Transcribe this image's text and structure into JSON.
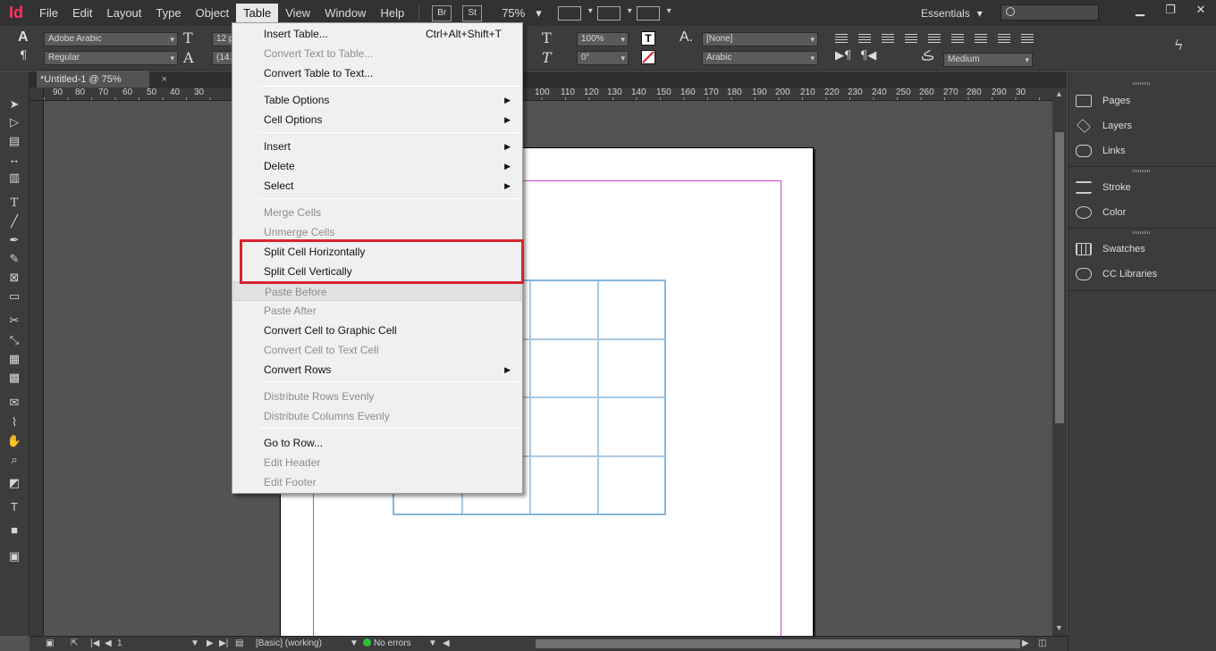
{
  "menubar": {
    "logo": "Id",
    "items": [
      "File",
      "Edit",
      "Layout",
      "Type",
      "Object",
      "Table",
      "View",
      "Window",
      "Help"
    ],
    "bridge": "Br",
    "stock": "St",
    "zoom": "75%",
    "zoom_arrow": "▾",
    "workspace": "Essentials",
    "workspace_arrow": "▾",
    "win_minimize": "▁",
    "win_restore": "❐",
    "win_close": "✕"
  },
  "control": {
    "font_family": "Adobe Arabic",
    "font_style": "Regular",
    "font_size": "12 p",
    "leading": "(14.4",
    "scale": "100%",
    "skew": "0°",
    "char_style": "[None]",
    "language": "Arabic",
    "kashida": "Medium"
  },
  "tab": {
    "title": "*Untitled-1 @ 75%",
    "close": "×"
  },
  "ruler_h": [
    "90",
    "80",
    "70",
    "60",
    "50",
    "40",
    "30",
    "100",
    "110",
    "120",
    "130",
    "140",
    "150",
    "160",
    "170",
    "180",
    "190",
    "200",
    "210",
    "220",
    "230",
    "240",
    "250",
    "260",
    "270",
    "280",
    "290",
    "30"
  ],
  "menu": {
    "items": [
      {
        "label": "Insert Table...",
        "shortcut": "Ctrl+Alt+Shift+T",
        "enabled": true,
        "submenu": false
      },
      {
        "label": "Convert Text to Table...",
        "enabled": false,
        "submenu": false
      },
      {
        "label": "Convert Table to Text...",
        "enabled": true,
        "submenu": false
      },
      {
        "label": "Table Options",
        "enabled": true,
        "submenu": true
      },
      {
        "label": "Cell Options",
        "enabled": true,
        "submenu": true
      },
      {
        "label": "Insert",
        "enabled": true,
        "submenu": true
      },
      {
        "label": "Delete",
        "enabled": true,
        "submenu": true
      },
      {
        "label": "Select",
        "enabled": true,
        "submenu": true
      },
      {
        "label": "Merge Cells",
        "enabled": false,
        "submenu": false
      },
      {
        "label": "Unmerge Cells",
        "enabled": false,
        "submenu": false
      },
      {
        "label": "Split Cell Horizontally",
        "enabled": true,
        "submenu": false
      },
      {
        "label": "Split Cell Vertically",
        "enabled": true,
        "submenu": false
      },
      {
        "label": "Paste Before",
        "enabled": false,
        "submenu": false
      },
      {
        "label": "Paste After",
        "enabled": false,
        "submenu": false
      },
      {
        "label": "Convert Cell to Graphic Cell",
        "enabled": true,
        "submenu": false
      },
      {
        "label": "Convert Cell to Text Cell",
        "enabled": false,
        "submenu": false
      },
      {
        "label": "Convert Rows",
        "enabled": true,
        "submenu": true
      },
      {
        "label": "Distribute Rows Evenly",
        "enabled": false,
        "submenu": false
      },
      {
        "label": "Distribute Columns Evenly",
        "enabled": false,
        "submenu": false
      },
      {
        "label": "Go to Row...",
        "enabled": true,
        "submenu": false
      },
      {
        "label": "Edit Header",
        "enabled": false,
        "submenu": false
      },
      {
        "label": "Edit Footer",
        "enabled": false,
        "submenu": false
      }
    ],
    "submenu_arrow": "▶"
  },
  "panels": {
    "group1": [
      "Pages",
      "Layers",
      "Links"
    ],
    "group2": [
      "Stroke",
      "Color"
    ],
    "group3": [
      "Swatches",
      "CC Libraries"
    ]
  },
  "status": {
    "page": "1",
    "style": "[Basic] (working)",
    "preflight": "No errors"
  },
  "colors": {
    "accent_logo": "#ff3366",
    "highlight_box": "#d9232e",
    "table_stroke": "#86b6dc",
    "margin_guide": "#d040d0",
    "preflight_ok": "#2fbf3a"
  }
}
